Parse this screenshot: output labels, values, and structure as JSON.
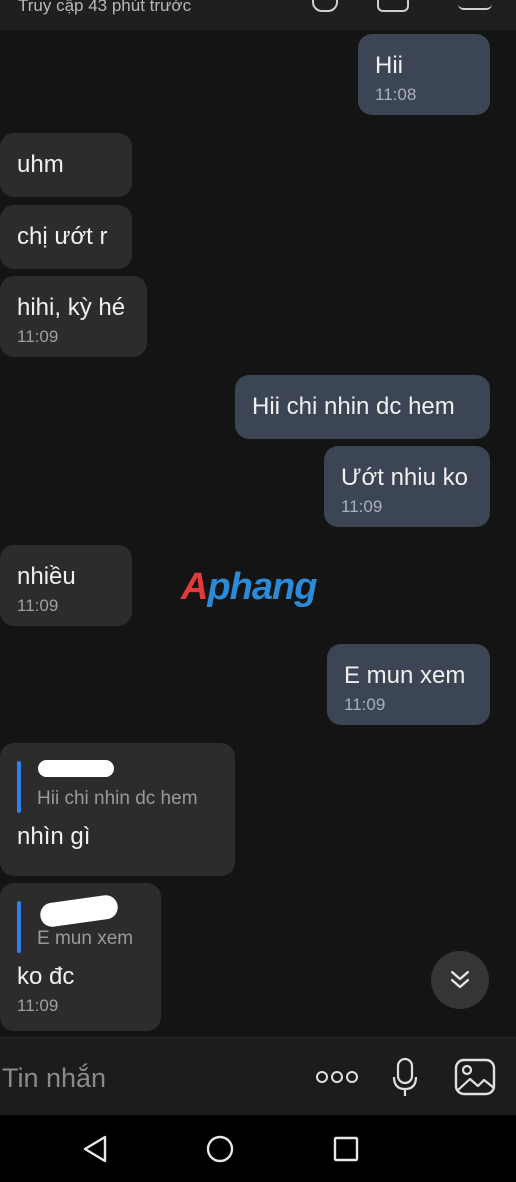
{
  "header": {
    "status": "Truy cập 43 phút trước"
  },
  "messages": {
    "m1": {
      "text": "Hii",
      "time": "11:08"
    },
    "m2": {
      "text": "uhm"
    },
    "m3": {
      "text": "chị ướt r"
    },
    "m4": {
      "text": "hihi, kỳ hé",
      "time": "11:09"
    },
    "m5": {
      "text": "Hii chi nhin dc hem"
    },
    "m6": {
      "text": "Ướt nhiu ko",
      "time": "11:09"
    },
    "m7": {
      "text": "nhiều",
      "time": "11:09"
    },
    "m8": {
      "text": "E mun xem",
      "time": "11:09"
    },
    "m9": {
      "quote": "Hii chi nhin dc hem",
      "text": "nhìn gì"
    },
    "m10": {
      "quote": "E mun xem",
      "text": "ko đc",
      "time": "11:09"
    }
  },
  "watermark": {
    "first": "A",
    "rest": "phang"
  },
  "input": {
    "placeholder": "Tin nhắn"
  },
  "icons": {
    "scroll_down": "double-chevron-down-icon",
    "more": "more-dots-icon",
    "mic": "microphone-icon",
    "image": "image-icon",
    "back": "back-triangle-icon",
    "home": "home-circle-icon",
    "recents": "recents-square-icon"
  },
  "colors": {
    "background": "#141414",
    "incoming_bubble": "#2c2c2c",
    "outgoing_bubble": "#3c4553",
    "quote_bar": "#2f80ed"
  }
}
